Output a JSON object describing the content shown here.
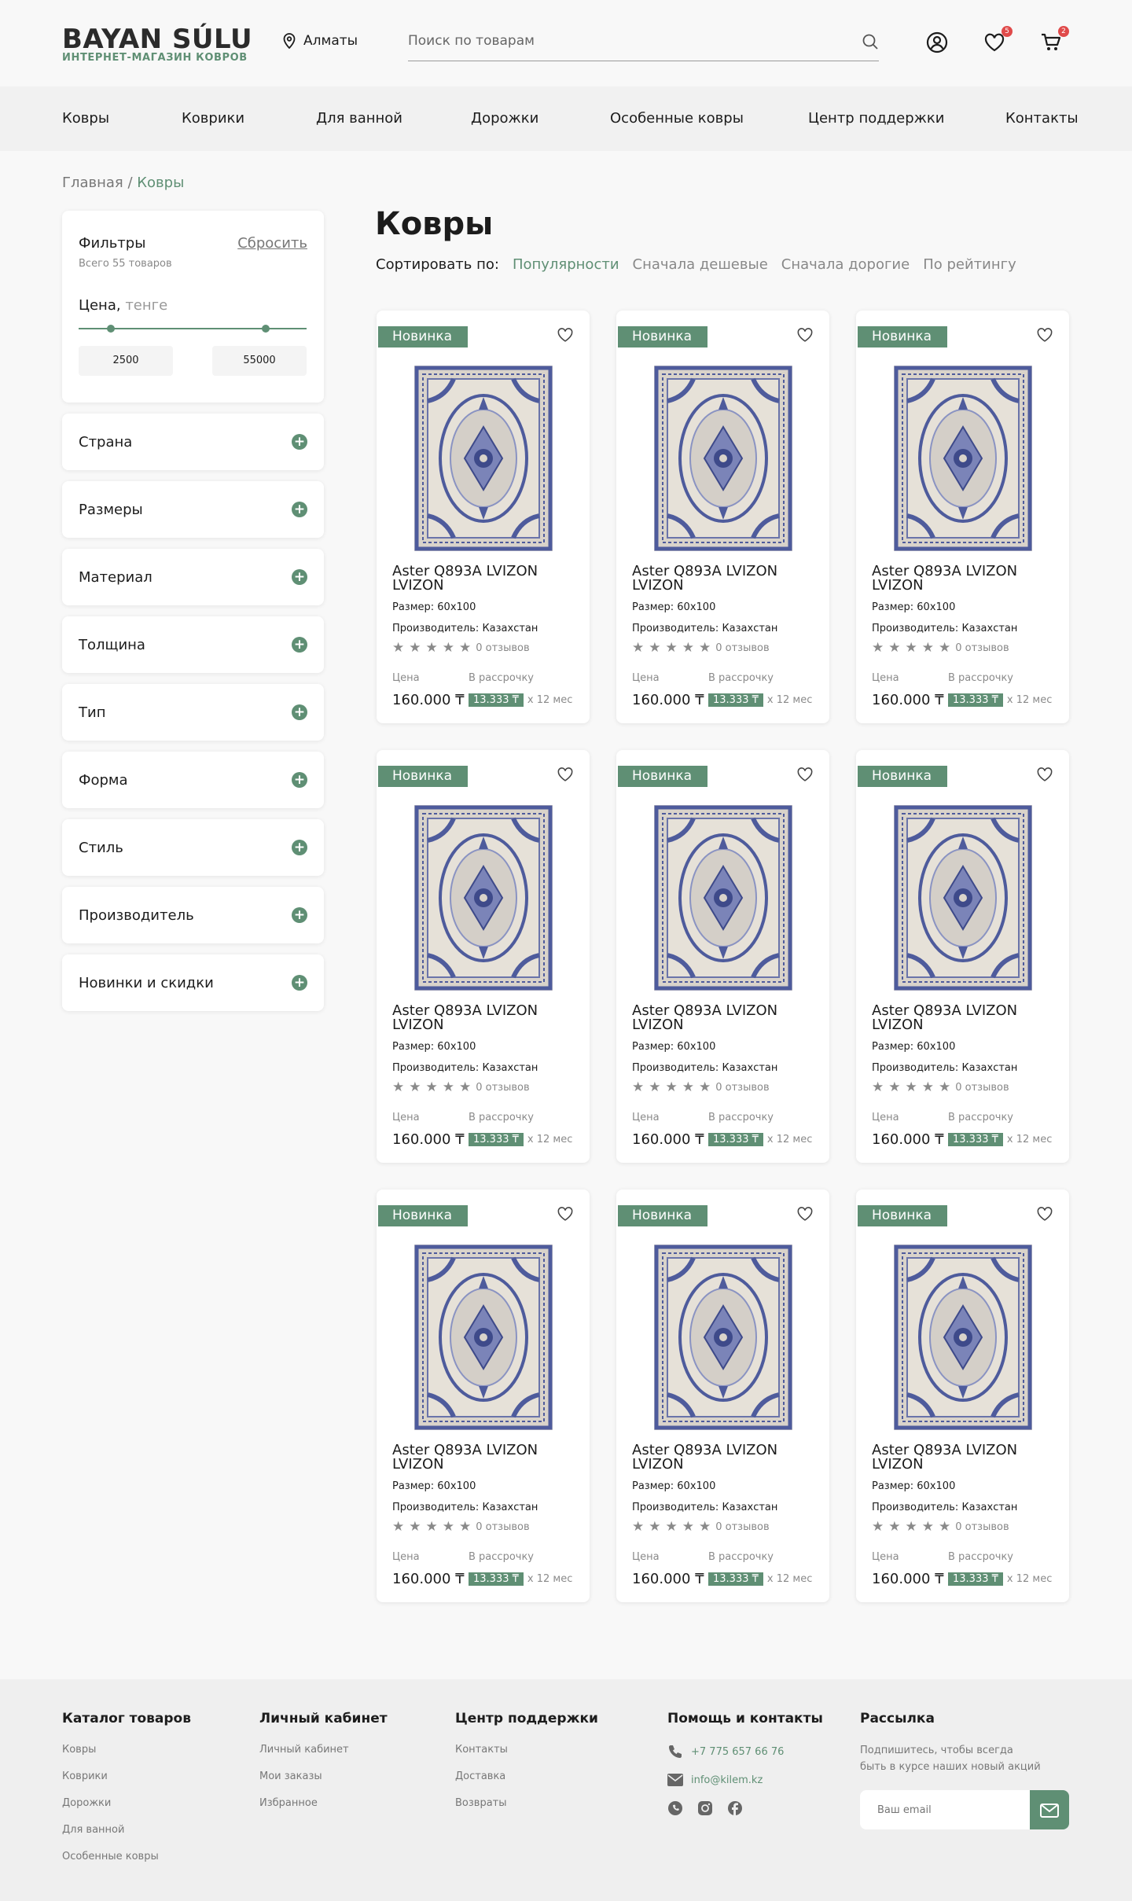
{
  "header": {
    "logo_main": "BAYAN SÚLU",
    "logo_sub": "ИНТЕРНЕТ-МАГАЗИН КОВРОВ",
    "city": "Алматы",
    "search_placeholder": "Поиск по товарам",
    "favorites_count": "5",
    "cart_count": "2"
  },
  "nav": {
    "items": [
      "Ковры",
      "Коврики",
      "Для ванной",
      "Дорожки",
      "Особенные ковры",
      "Центр поддержки",
      "Контакты"
    ]
  },
  "breadcrumb": {
    "home": "Главная",
    "sep": " / ",
    "current": "Ковры"
  },
  "filters": {
    "title": "Фильтры",
    "reset": "Сбросить",
    "total": "Всего 55 товаров",
    "price_label": "Цена,",
    "price_unit": "тенге",
    "price_min": "2500",
    "price_max": "55000",
    "sections": [
      "Страна",
      "Размеры",
      "Материал",
      "Толщина",
      "Тип",
      "Форма",
      "Стиль",
      "Производитель",
      "Новинки и скидки"
    ]
  },
  "main": {
    "title": "Ковры",
    "sort_label": "Сортировать по:",
    "sort_options": [
      "Популярности",
      "Сначала дешевые",
      "Сначала дорогие",
      "По рейтингу"
    ],
    "sort_active": "Популярности"
  },
  "product_template": {
    "tag": "Новинка",
    "name": "Aster Q893A LVIZON LVIZON",
    "size": "Размер: 60х100",
    "maker": "Производитель: Казахстан",
    "reviews": "0 отзывов",
    "rating": 0,
    "price_label": "Цена",
    "installment_label": "В рассрочку",
    "price": "160.000 ₸",
    "monthly": "13.333 ₸",
    "term": "х 12 мес"
  },
  "footer": {
    "catalog": {
      "title": "Каталог товаров",
      "links": [
        "Ковры",
        "Коврики",
        "Дорожки",
        "Для ванной",
        "Особенные ковры"
      ]
    },
    "account": {
      "title": "Личный кабинет",
      "links": [
        "Личный кабинет",
        "Мои заказы",
        "Избранное"
      ]
    },
    "support": {
      "title": "Центр поддержки",
      "links": [
        "Контакты",
        "Доставка",
        "Возвраты"
      ]
    },
    "contacts": {
      "title": "Помощь и контакты",
      "phone": "+7 775 657 66 76",
      "email": "info@kilem.kz"
    },
    "newsletter": {
      "title": "Рассылка",
      "text1": "Подпишитесь, чтобы всегда",
      "text2": "быть в курсе наших новый акций",
      "placeholder": "Ваш email"
    }
  },
  "colors": {
    "accent": "#5f8f74",
    "badge": "#e04a4a",
    "rug_base": "#d9d3ca",
    "rug_pattern": "#4e5b9c"
  }
}
